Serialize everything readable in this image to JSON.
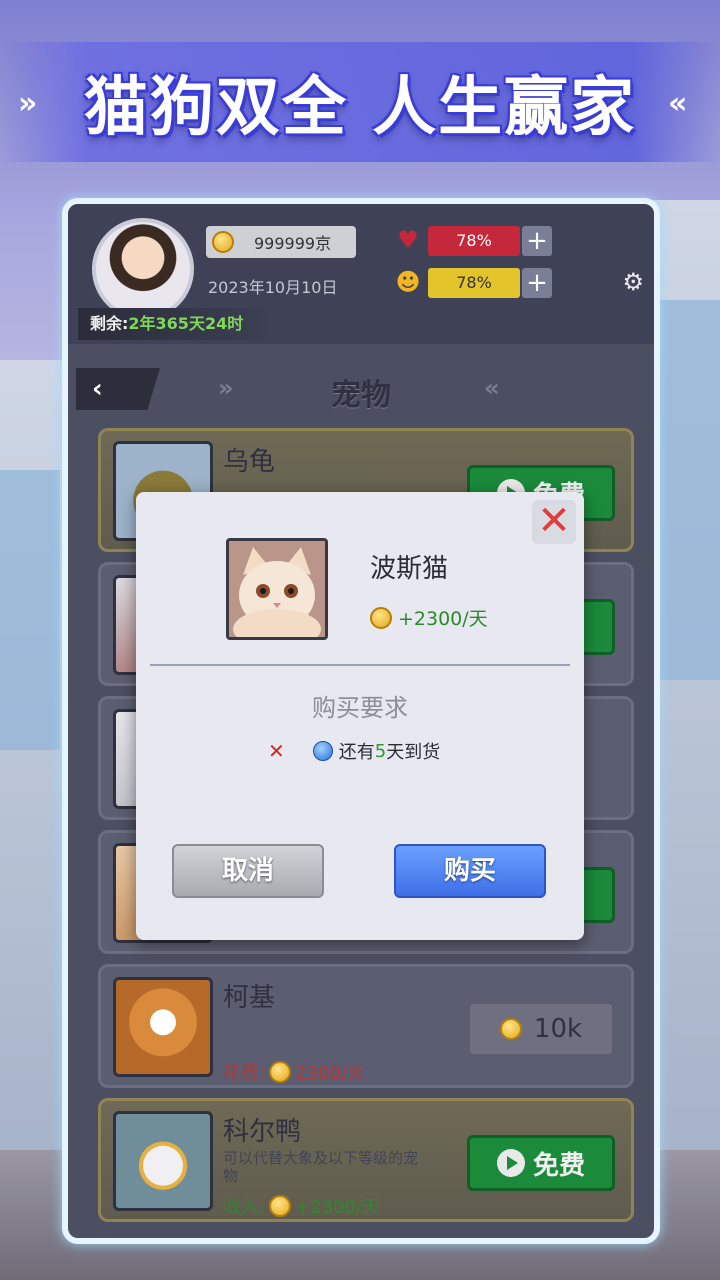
{
  "banner": {
    "title": "猫狗双全 人生赢家"
  },
  "header": {
    "coins": "999999京",
    "date": "2023年10月10日",
    "health_percent": "78%",
    "mood_percent": "78%",
    "remaining_prefix": "剩余:",
    "remaining_value": "2年365天24时"
  },
  "page": {
    "title": "宠物"
  },
  "pets": [
    {
      "name": "乌龟",
      "action": "免费"
    },
    {
      "name": "",
      "action": ""
    },
    {
      "name": "",
      "action": ""
    },
    {
      "name": "",
      "action": ""
    },
    {
      "name": "柯基",
      "cost_label": "花费:",
      "cost": "2300/天",
      "price": "10k"
    },
    {
      "name": "科尔鸭",
      "desc": "可以代替大象及以下等级的宠物",
      "income_label": "收入:",
      "income": "+2300/天",
      "action": "免费"
    }
  ],
  "dialog": {
    "pet_name": "波斯猫",
    "income": "+2300/天",
    "requirement_title": "购买要求",
    "requirement_prefix": "还有",
    "requirement_days": "5",
    "requirement_suffix": "天到货",
    "cancel_label": "取消",
    "buy_label": "购买"
  },
  "colors": {
    "buy": "#3f6fe6",
    "free": "#1b8a3b",
    "health": "#c5283b",
    "mood": "#e3c42b"
  }
}
